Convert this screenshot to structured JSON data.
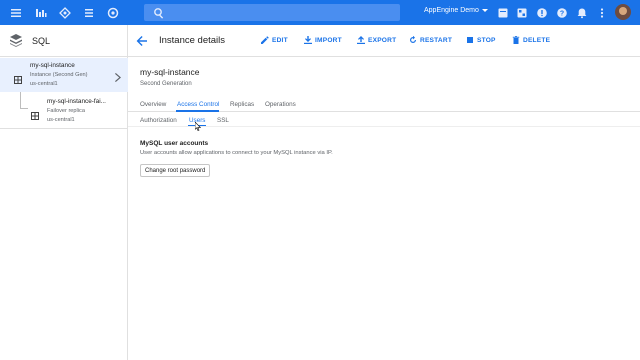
{
  "topbar": {
    "search_placeholder": "",
    "project_name": "AppEngine Demo",
    "icons": [
      "menu-icon",
      "dashboard-icon",
      "network-icon",
      "list-icon",
      "settings-icon",
      "search-icon",
      "dropdown-icon",
      "gift-icon",
      "apps-icon",
      "alert-icon",
      "help-icon",
      "notifications-icon",
      "more-icon"
    ]
  },
  "sidebar": {
    "title": "SQL",
    "instances": [
      {
        "name": "my-sql-instance",
        "type": "Instance (Second Gen)",
        "region": "us-central1"
      },
      {
        "name": "my-sql-instance-fai...",
        "type": "Failover replica",
        "region": "us-central1"
      }
    ]
  },
  "toolbar": {
    "title": "Instance details",
    "actions": [
      "EDIT",
      "IMPORT",
      "EXPORT",
      "RESTART",
      "STOP",
      "DELETE"
    ]
  },
  "instance": {
    "name": "my-sql-instance",
    "generation": "Second Generation"
  },
  "tabs": [
    "Overview",
    "Access Control",
    "Replicas",
    "Operations"
  ],
  "active_tab": "Access Control",
  "subtabs": [
    "Authorization",
    "Users",
    "SSL"
  ],
  "active_subtab": "Users",
  "users_section": {
    "title": "MySQL user accounts",
    "description": "User accounts allow applications to connect to your MySQL instance via IP.",
    "button": "Change root password"
  },
  "colors": {
    "accent": "#1a73e8",
    "selected_bg": "#e8f0fe"
  }
}
